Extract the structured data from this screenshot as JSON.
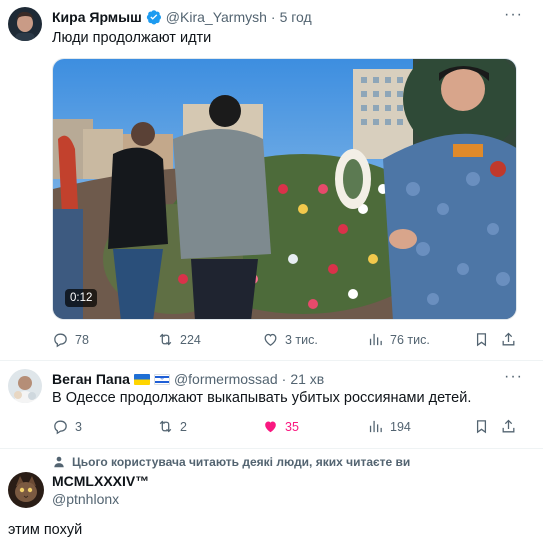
{
  "tweet1": {
    "display_name": "Кира Ярмыш",
    "handle": "@Kira_Yarmysh",
    "separator": "·",
    "time": "5 год",
    "text": "Люди продолжают идти",
    "video_timestamp": "0:12",
    "replies": "78",
    "retweets": "224",
    "likes": "3 тис.",
    "views": "76 тис."
  },
  "tweet2": {
    "display_name": "Веган Папа",
    "handle": "@formermossad",
    "separator": "·",
    "time": "21 хв",
    "text": "В Одессе продолжают выкапывать убитых россиянами детей.",
    "replies": "3",
    "retweets": "2",
    "likes": "35",
    "views": "194",
    "like_color": "#f91880"
  },
  "tweet3": {
    "social_context": "Цього користувача читають деякі люди, яких читаєте ви",
    "display_name": "MCMLXXXIV™",
    "handle": "@ptnhlonx",
    "text": "этим похуй"
  },
  "colors": {
    "verified": "#1d9bf0",
    "muted": "#536471"
  }
}
